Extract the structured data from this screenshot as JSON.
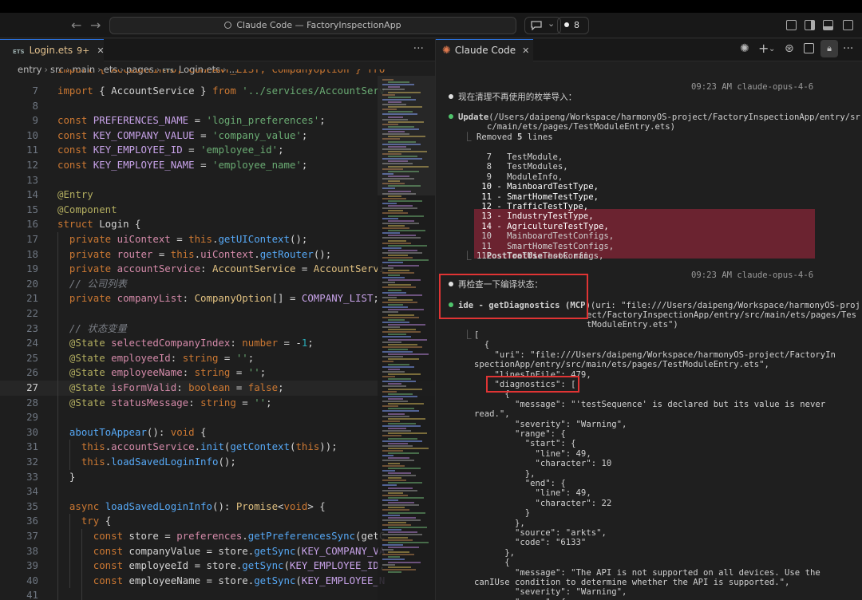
{
  "titlebar": {
    "back": "←",
    "forward": "→",
    "search_text": "Claude Code — FactoryInspectionApp",
    "chat_caret": "⌄",
    "badge_count": "8"
  },
  "editor": {
    "tab": {
      "lang_tag": "ETS",
      "name": "Login.ets",
      "count": "9+",
      "close": "✕"
    },
    "more": "···",
    "breadcrumb": [
      "entry",
      "src",
      "main",
      "ets",
      "pages",
      "Login.ets",
      "..."
    ],
    "line_numbers": [
      "7",
      "8",
      "9",
      "10",
      "11",
      "12",
      "13",
      "14",
      "15",
      "16",
      "17",
      "18",
      "19",
      "20",
      "21",
      "22",
      "23",
      "24",
      "25",
      "26",
      "27",
      "28",
      "29",
      "30",
      "31",
      "32",
      "33",
      "34",
      "35",
      "36",
      "37",
      "38",
      "39",
      "40",
      "41"
    ],
    "current_line": "27",
    "top_partial": "import { AccountInfo, COMPANY_LIST, CompanyOption } fro"
  },
  "panel": {
    "tab_label": "Claude Code",
    "tab_close": "✕",
    "tools_more": "···",
    "msg1_time": "09:23 AM claude-opus-4-6",
    "msg1_text": "现在清理不再使用的枚举导入：",
    "update_label": "Update",
    "update_path_1": "(/Users/daipeng/Workspace/harmonyOS-project/FactoryInspectionApp/entry/sr",
    "update_path_2": "c/main/ets/pages/TestModuleEntry.ets)",
    "removed_prefix": "Removed ",
    "removed_count": "5",
    "removed_suffix": " lines",
    "diff_lines": [
      {
        "n": "7",
        "mark": " ",
        "text": "TestModule,"
      },
      {
        "n": "8",
        "mark": " ",
        "text": "TestModules,"
      },
      {
        "n": "9",
        "mark": " ",
        "text": "ModuleInfo,"
      },
      {
        "n": "10",
        "mark": "-",
        "text": "MainboardTestType,"
      },
      {
        "n": "11",
        "mark": "-",
        "text": "SmartHomeTestType,"
      },
      {
        "n": "12",
        "mark": "-",
        "text": "TrafficTestType,"
      },
      {
        "n": "13",
        "mark": "-",
        "text": "IndustryTestType,"
      },
      {
        "n": "14",
        "mark": "-",
        "text": "AgricultureTestType,"
      },
      {
        "n": "10",
        "mark": " ",
        "text": "MainboardTestConfigs,"
      },
      {
        "n": "11",
        "mark": " ",
        "text": "SmartHomeTestConfigs,"
      },
      {
        "n": "12",
        "mark": " ",
        "text": "TrafficTestConfigs,"
      }
    ],
    "hook_count": "1",
    "hook_label": "PostToolUse",
    "hook_suffix": " hook ran",
    "msg2_time": "09:23 AM claude-opus-4-6",
    "msg2_text": "再检查一下编译状态：",
    "tool_name": "ide - getDiagnostics (MCP)",
    "tool_args_1": "(uri: \"file:///Users/daipeng/Workspace/harmonyOS-proj",
    "tool_args_2": "ect/FactoryInspectionApp/entry/src/main/ets/pages/Tes",
    "tool_args_3": "tModuleEntry.ets\")",
    "json_lines": [
      "[",
      "  {",
      "    \"uri\": \"file:///Users/daipeng/Workspace/harmonyOS-project/FactoryIn",
      "spectionApp/entry/src/main/ets/pages/TestModuleEntry.ets\",",
      "    \"linesInFile\": 479,",
      "    \"diagnostics\": [",
      "      {",
      "        \"message\": \"'testSequence' is declared but its value is never",
      "read.\",",
      "        \"severity\": \"Warning\",",
      "        \"range\": {",
      "          \"start\": {",
      "            \"line\": 49,",
      "            \"character\": 10",
      "          },",
      "          \"end\": {",
      "            \"line\": 49,",
      "            \"character\": 22",
      "          }",
      "        },",
      "        \"source\": \"arkts\",",
      "        \"code\": \"6133\"",
      "      },",
      "      {",
      "        \"message\": \"The API is not supported on all devices. Use the",
      "canIUse condition to determine whether the API is supported.\",",
      "        \"severity\": \"Warning\",",
      "        \"range\": {"
    ]
  },
  "colors": {
    "accent_blue": "#2a6fd6",
    "claude_orange": "#e07a4f",
    "diff_removed": "#6b2330",
    "highlight_box": "#e03434",
    "status_green": "#4fc36b"
  }
}
